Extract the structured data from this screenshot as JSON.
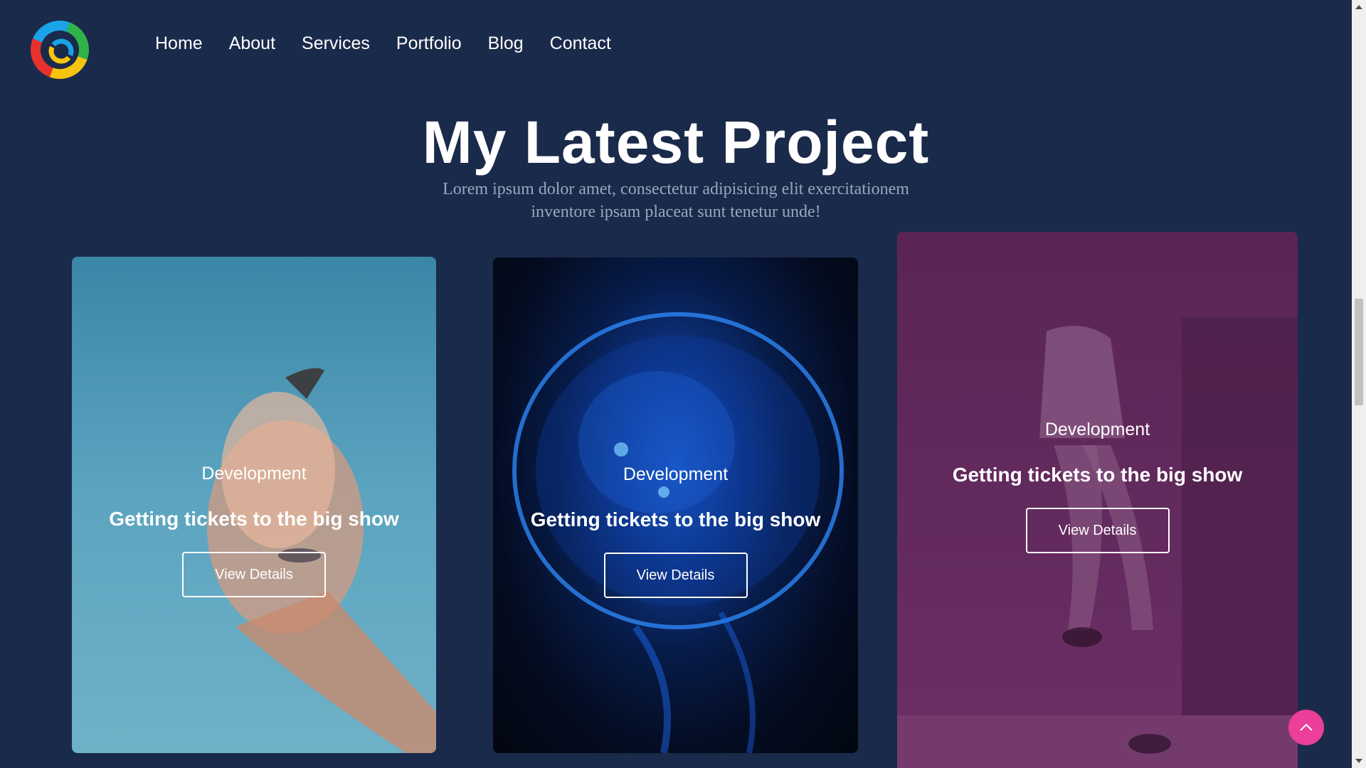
{
  "nav": {
    "items": [
      {
        "label": "Home"
      },
      {
        "label": "About"
      },
      {
        "label": "Services"
      },
      {
        "label": "Portfolio"
      },
      {
        "label": "Blog"
      },
      {
        "label": "Contact"
      }
    ]
  },
  "section": {
    "title": "My Latest Project",
    "subtitle": "Lorem ipsum dolor amet, consectetur adipisicing elit exercitationem inventore ipsam placeat sunt tenetur unde!"
  },
  "cards": [
    {
      "category": "Development",
      "title": "Getting tickets to the big show",
      "button": "View Details",
      "image": "hand-portrait-photo",
      "tint": "#3a86a6"
    },
    {
      "category": "Development",
      "title": "Getting tickets to the big show",
      "button": "View Details",
      "image": "jellyfish-photo",
      "tint": "#0e3a94"
    },
    {
      "category": "Development",
      "title": "Getting tickets to the big show",
      "button": "View Details",
      "image": "seated-person-photo",
      "tint": "#5a2554"
    }
  ],
  "colors": {
    "background": "#1a2a4a",
    "accent": "#ec3f9a",
    "subtitle": "#9aa6bf"
  },
  "icons": {
    "logo": "circular-multicolor-logo",
    "scroll_top": "chevron-up-icon"
  }
}
